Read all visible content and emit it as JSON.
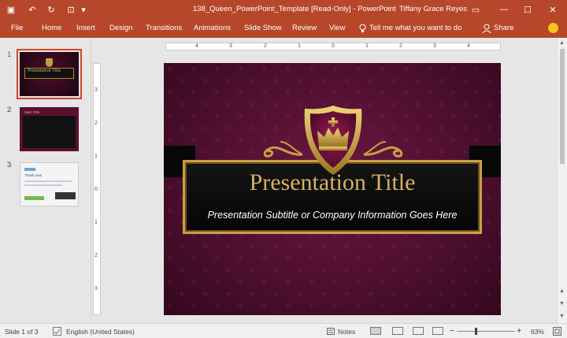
{
  "titlebar": {
    "document_title": "138_Queen_PowerPoint_Template [Read-Only]  -  PowerPoint",
    "user": "Tiffany Grace Reyes",
    "qat": [
      {
        "name": "save-icon",
        "glyph": "▣"
      },
      {
        "name": "undo-icon",
        "glyph": "↶"
      },
      {
        "name": "redo-icon",
        "glyph": "↻"
      },
      {
        "name": "present-icon",
        "glyph": "⊡"
      },
      {
        "name": "customize-icon",
        "glyph": "▾"
      }
    ],
    "window_buttons": [
      {
        "name": "ribbon-display-icon",
        "glyph": "▭"
      },
      {
        "name": "minimize-icon",
        "glyph": "—"
      },
      {
        "name": "maximize-icon",
        "glyph": "☐"
      },
      {
        "name": "close-icon",
        "glyph": "✕"
      }
    ]
  },
  "ribbon": {
    "tabs": [
      "File",
      "Home",
      "Insert",
      "Design",
      "Transitions",
      "Animations",
      "Slide Show",
      "Review",
      "View"
    ],
    "tell_me": "Tell me what you want to do",
    "share": "Share",
    "accent": "#b7472a"
  },
  "thumbnails": [
    {
      "number": "1",
      "selected": true,
      "title": "Presentation Title"
    },
    {
      "number": "2",
      "selected": false,
      "title": "Main Title"
    },
    {
      "number": "3",
      "selected": false,
      "title": "Thank you!"
    }
  ],
  "ruler": {
    "horizontal": [
      "4",
      "3",
      "2",
      "1",
      "0",
      "1",
      "2",
      "3",
      "4"
    ],
    "vertical": [
      "3",
      "2",
      "1",
      "0",
      "1",
      "2",
      "3"
    ]
  },
  "slide": {
    "title": "Presentation Title",
    "subtitle": "Presentation Subtitle or Company Information Goes Here",
    "gold": "#d7b160",
    "background": "#5a1136"
  },
  "status": {
    "slide_indicator": "Slide 1 of 3",
    "language": "English (United States)",
    "notes": "Notes",
    "zoom_minus": "−",
    "zoom_plus": "+",
    "zoom": "63%"
  }
}
